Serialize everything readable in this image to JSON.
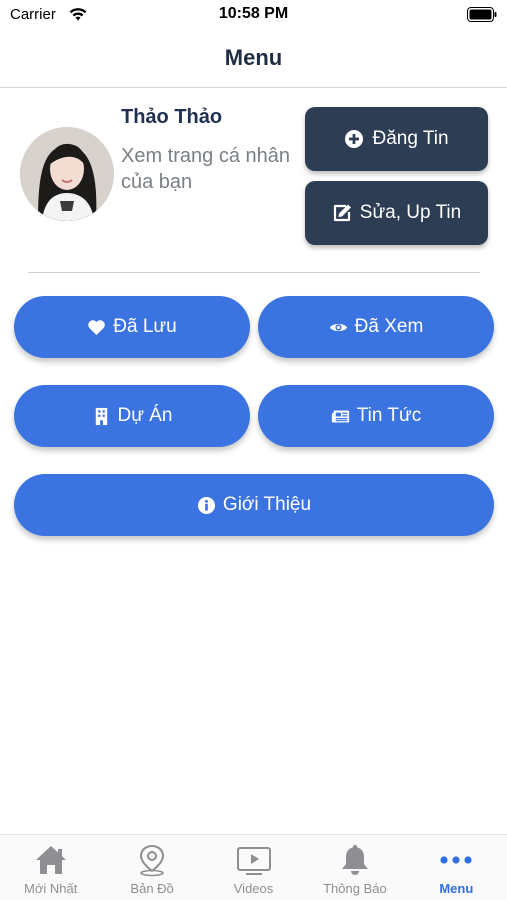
{
  "status_bar": {
    "carrier": "Carrier",
    "time": "10:58 PM"
  },
  "nav": {
    "title": "Menu"
  },
  "profile": {
    "name": "Thảo Thảo",
    "subtitle": "Xem trang cá nhân của bạn"
  },
  "actions": {
    "post": "Đăng Tin",
    "edit": "Sửa, Up Tin"
  },
  "menu": {
    "saved": "Đã Lưu",
    "viewed": "Đã Xem",
    "projects": "Dự Án",
    "news": "Tin Tức",
    "about": "Giới Thiệu"
  },
  "tabs": [
    {
      "label": "Mới Nhất",
      "icon": "home-icon"
    },
    {
      "label": "Bản Đồ",
      "icon": "map-pin-icon"
    },
    {
      "label": "Videos",
      "icon": "video-icon"
    },
    {
      "label": "Thông Báo",
      "icon": "bell-icon"
    },
    {
      "label": "Menu",
      "icon": "more-dots-icon",
      "active": true
    }
  ],
  "colors": {
    "primary_blue": "#3b74e0",
    "dark_navy": "#2d3d54",
    "tab_active": "#2f6fe0",
    "tab_inactive": "#8e8e93"
  }
}
